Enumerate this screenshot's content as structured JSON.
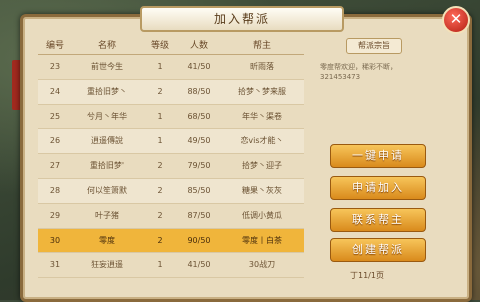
{
  "title": "加入帮派",
  "close_icon": "close-icon",
  "table": {
    "headers": [
      "编号",
      "名称",
      "等级",
      "人数",
      "帮主"
    ],
    "rows": [
      {
        "id": "23",
        "name": "前世今生",
        "level": "1",
        "members": "41/50",
        "leader": "昕雨落"
      },
      {
        "id": "24",
        "name": "重拾旧梦丶",
        "level": "2",
        "members": "88/50",
        "leader": "拾梦丶梦来服"
      },
      {
        "id": "25",
        "name": "兮月丶年华",
        "level": "1",
        "members": "68/50",
        "leader": "年华丶渠卷"
      },
      {
        "id": "26",
        "name": "逍遥傳說",
        "level": "1",
        "members": "49/50",
        "leader": "恋vis才能丶"
      },
      {
        "id": "27",
        "name": "重拾旧梦'",
        "level": "2",
        "members": "79/50",
        "leader": "拾梦丶迎子"
      },
      {
        "id": "28",
        "name": "何以笙箫默",
        "level": "2",
        "members": "85/50",
        "leader": "糖果丶灰灰"
      },
      {
        "id": "29",
        "name": "叶子猪",
        "level": "2",
        "members": "87/50",
        "leader": "低调小黄瓜"
      },
      {
        "id": "30",
        "name": "零度",
        "level": "2",
        "members": "90/50",
        "leader": "零度丨白茶"
      },
      {
        "id": "31",
        "name": "狂妄逍遥",
        "level": "1",
        "members": "41/50",
        "leader": "30战刀"
      }
    ],
    "selected_index": 7
  },
  "info": {
    "label": "帮派宗旨",
    "text": "零度帮欢迎，稀彩不断，321453473"
  },
  "buttons": {
    "one_key": "一键申请",
    "apply": "申请加入",
    "contact": "联系帮主",
    "create": "创建帮派"
  },
  "footnote": "丁11/1页"
}
